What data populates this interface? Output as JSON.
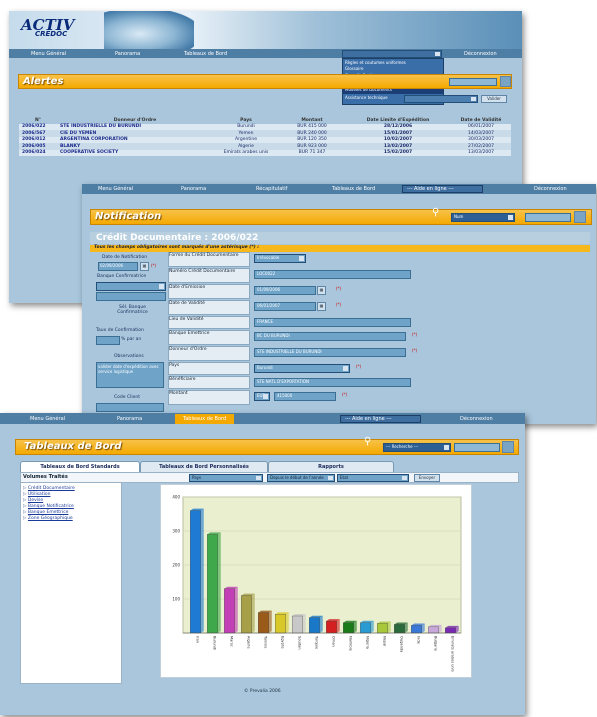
{
  "logo": {
    "text": "ACTIV",
    "sub": "CREDOC"
  },
  "win1": {
    "nav": [
      "Menu Général",
      "Panorama",
      "Tableaux de Bord",
      "Déconnexion"
    ],
    "dropdown_items": [
      "Règles et coutumes uniformes",
      "Glossaire",
      "Conseils Pratiques",
      "Réglementation",
      "Modèles de Documents",
      "Assistance technique"
    ],
    "title": "Alertes",
    "valider": "Valider",
    "headers": [
      "N°",
      "Donneur d'Ordre",
      "Pays",
      "Montant",
      "Date Limite d'Expédition",
      "Date de Validité"
    ],
    "rows": [
      [
        "2006/022",
        "STE INDUSTRIELLE DU BURUNDI",
        "Burundi",
        "BUR 415 000",
        "28/12/2006",
        "06/01/2007"
      ],
      [
        "2006/567",
        "CIE DU YEMEN",
        "Yemen",
        "BUR 240 000",
        "15/01/2007",
        "14/03/2007"
      ],
      [
        "2006/012",
        "ARGENTINA CORPORATION",
        "Argentine",
        "BUR 120 350",
        "10/02/2007",
        "30/03/2007"
      ],
      [
        "2006/005",
        "BLANKY",
        "Algerie",
        "BUR 923 000",
        "13/02/2007",
        "27/02/2007"
      ],
      [
        "2006/024",
        "COOPERATIVE SOCIETY",
        "Emirats arabes unis",
        "BUR 71 347",
        "15/02/2007",
        "13/03/2007"
      ]
    ]
  },
  "win2": {
    "nav": [
      "Menu Général",
      "Panorama",
      "Récapitulatif",
      "Tableaux de Bord",
      "--- Aide en ligne ---",
      "Déconnexion"
    ],
    "title": "Notification",
    "search_select": "Num",
    "subtitle": "Crédit Documentaire : 2006/022",
    "mandatory": "Tous les champs obligatoires sont marqués d'une astérisque (*) :",
    "left_fields": [
      "Date de Notification",
      "Banque Confirmatrice",
      "Sél. Banque Confirmatrice",
      "Taux de Confirmation",
      "% par an",
      "Observations",
      "valider date d'expédition avec service logistique",
      "Code Client"
    ],
    "notif_date": "02/09/2006",
    "form_labels": [
      "Forme du Crédit Documentaire",
      "Numéro Crédit Documentaire",
      "Date d'Emission",
      "Date de Validité",
      "Lieu de Validité",
      "Banque Emettrice",
      "Donneur d'Ordre",
      "Pays",
      "Bénéficiaire",
      "Montant"
    ],
    "form_values": [
      "Irrévocable",
      "LOC0022",
      "01/09/2006",
      "06/01/2007",
      "FRANCE",
      "BC DU BURUNDI",
      "STE INDUSTRIELLE DU BURUNDI",
      "Burundi",
      "STE NATL D'EXPORTATION",
      "EUR",
      "415000"
    ],
    "star": "(*)"
  },
  "win3": {
    "nav": [
      "Menu Général",
      "Panorama",
      "Tableaux de Bord",
      "--- Aide en ligne ---",
      "Déconnexion"
    ],
    "title": "Tableaux de Bord",
    "search_select": "--- Recherche ---",
    "tabs": [
      "Tableaux de Bord Standards",
      "Tableaux de Bord Personnalisés",
      "Rapports"
    ],
    "section": "Volumes Traités",
    "filters": [
      "Pays",
      "Depuis le début de l'année",
      "Etat"
    ],
    "envoyer": "Envoyer",
    "links": [
      "Crédit Documentaire",
      "Utilisation",
      "Devise",
      "Banque Notificatrice",
      "Banque Emettrice",
      "Zone Géographique"
    ],
    "footer": "© Prevalia 2006"
  },
  "chart_data": {
    "type": "bar",
    "categories": [
      "Iran",
      "Burundi",
      "Maroc",
      "Algerie",
      "Tunisie",
      "Egypte",
      "Soudan",
      "Turquie",
      "Oman",
      "Namibie",
      "Nigeria",
      "Nepal",
      "Ouganda",
      "Inde",
      "Bulgarie",
      "Emirats arabes unis"
    ],
    "values": [
      360,
      290,
      130,
      110,
      60,
      55,
      50,
      45,
      35,
      30,
      30,
      28,
      25,
      22,
      18,
      15
    ],
    "colors": [
      "#1e7ad2",
      "#3fa84a",
      "#c23fb5",
      "#a8a048",
      "#9a5a1a",
      "#d8c82a",
      "#c8c8c8",
      "#1a78c8",
      "#d42020",
      "#1a7a1a",
      "#2a9ad2",
      "#a8c83a",
      "#2a6a3a",
      "#3a78d8",
      "#c8a8d8",
      "#7a2ab2"
    ],
    "yticks": [
      "400",
      "300",
      "200",
      "100"
    ],
    "ylim": [
      0,
      400
    ]
  }
}
